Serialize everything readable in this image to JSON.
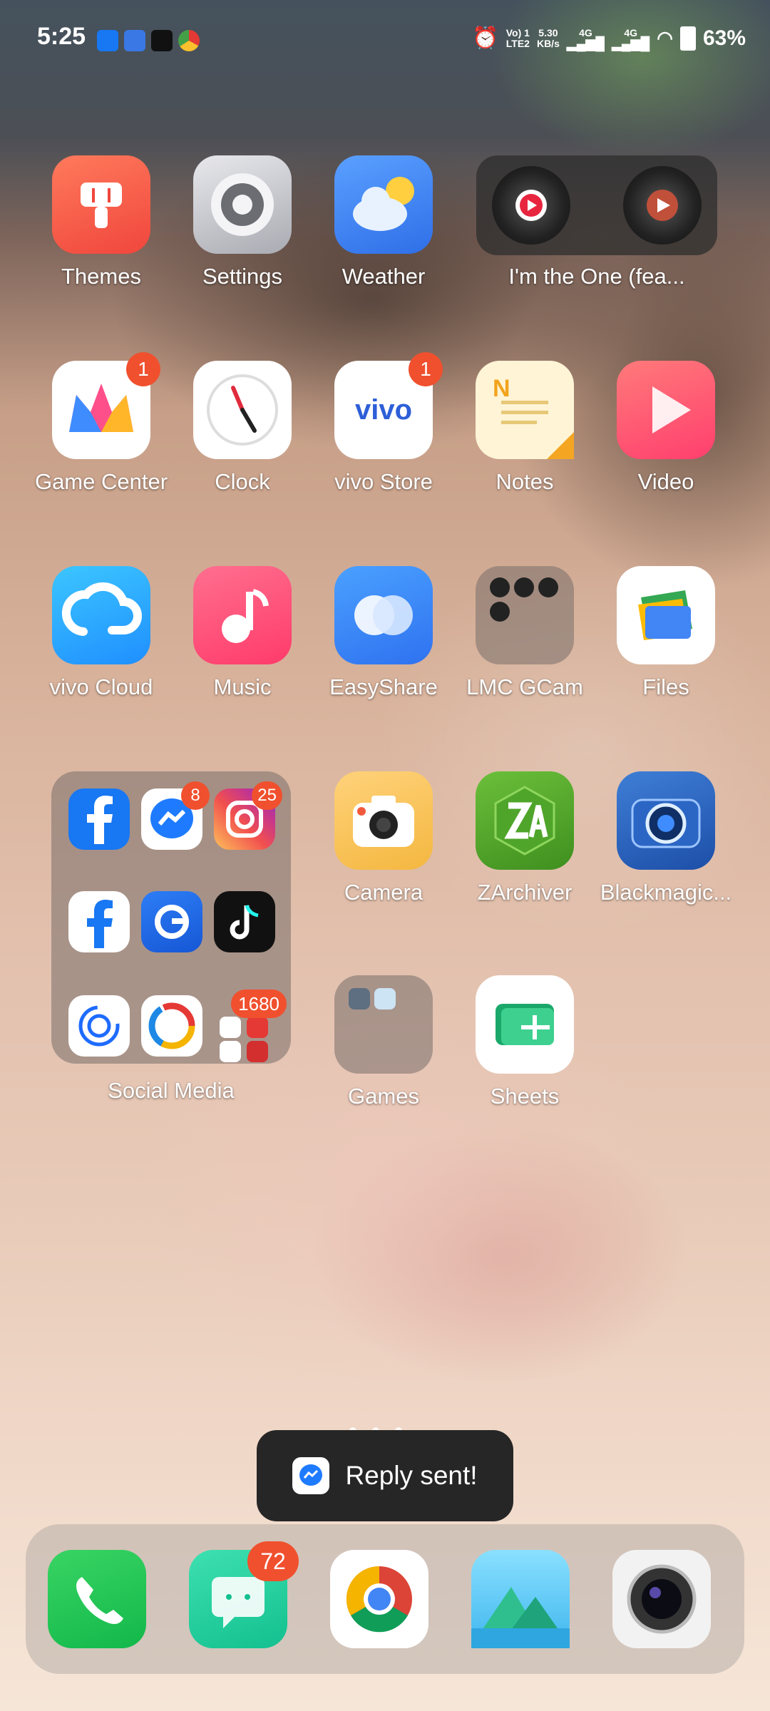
{
  "status": {
    "time": "5:25",
    "volte_top": "Vo) 1",
    "volte_bottom": "LTE2",
    "speed_value": "5.30",
    "speed_unit": "KB/s",
    "net1": "4G",
    "net2": "4G",
    "battery": "63%"
  },
  "apps": {
    "themes": "Themes",
    "settings": "Settings",
    "weather": "Weather",
    "music_widget": "I'm the One (fea...",
    "game_center": "Game Center",
    "game_center_badge": "1",
    "clock": "Clock",
    "vivo_store": "vivo Store",
    "vivo_store_badge": "1",
    "vivo_logo": "vivo",
    "notes": "Notes",
    "notes_letter": "N",
    "video": "Video",
    "vivo_cloud": "vivo Cloud",
    "music": "Music",
    "easyshare": "EasyShare",
    "lmc_gcam": "LMC GCam",
    "files": "Files",
    "camera": "Camera",
    "zarchiver": "ZArchiver",
    "blackmagic": "Blackmagic...",
    "games": "Games",
    "sheets": "Sheets"
  },
  "social_folder": {
    "label": "Social Media",
    "messenger_badge": "8",
    "instagram_badge": "25",
    "more_badge": "1680"
  },
  "dock": {
    "messages_badge": "72"
  },
  "toast": {
    "text": "Reply sent!"
  }
}
